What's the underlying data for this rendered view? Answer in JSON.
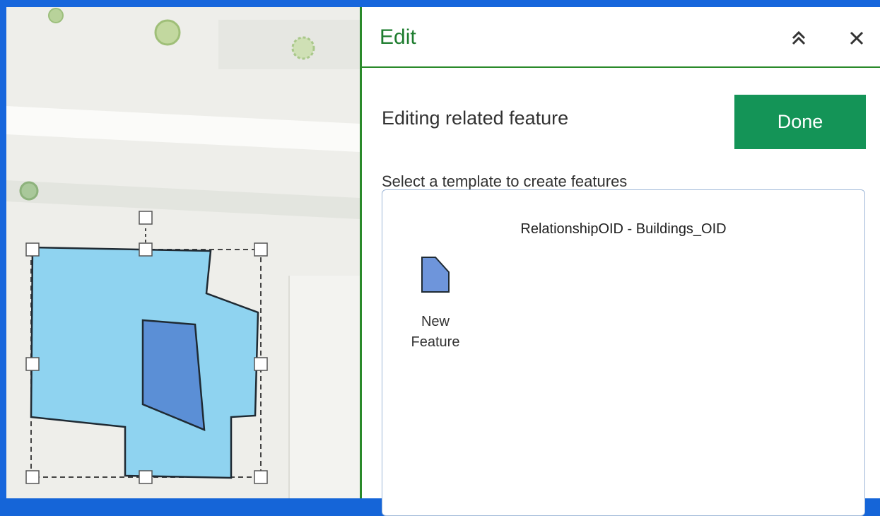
{
  "panel": {
    "title": "Edit",
    "subheading": "Editing related feature",
    "done_label": "Done",
    "template_instruction": "Select a template to create features",
    "layer_title": "RelationshipOID - Buildings_OID",
    "template": {
      "label_line1": "New",
      "label_line2": "Feature"
    }
  },
  "icons": {
    "collapse": "chevrons-up-icon",
    "close": "close-icon",
    "template_swatch": "polygon-swatch-icon"
  },
  "colors": {
    "accent_green": "#1e7d2f",
    "done_button": "#149457",
    "outer_polygon_fill": "#8fd3f0",
    "inner_polygon_fill": "#5b8fd6",
    "window_border": "#1766dc"
  }
}
